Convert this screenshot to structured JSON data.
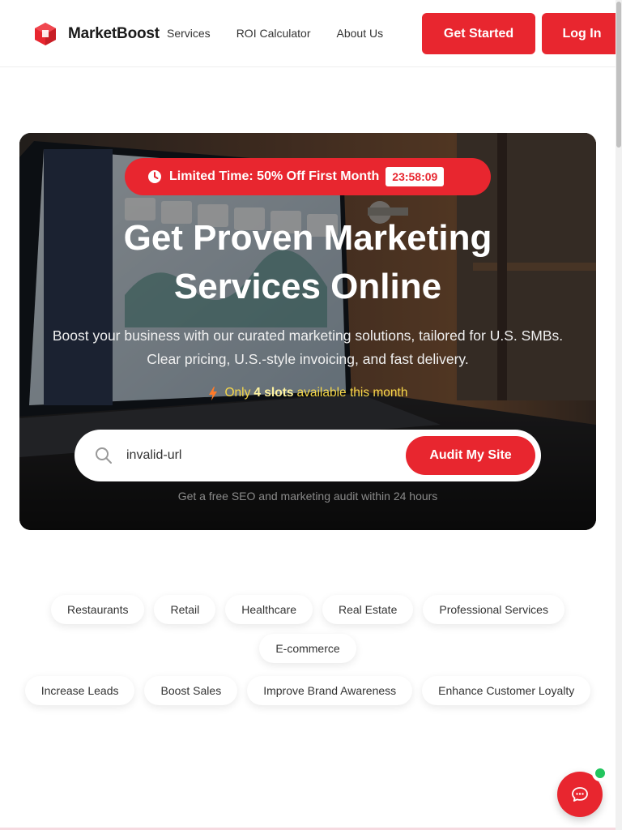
{
  "header": {
    "brand": "MarketBoost",
    "nav": [
      "Services",
      "ROI Calculator",
      "About Us"
    ],
    "get_started": "Get Started",
    "login": "Log In"
  },
  "hero": {
    "promo_text": "Limited Time: 50% Off First Month",
    "countdown": "23:58:09",
    "title_line1": "Get Proven Marketing",
    "title_line2": "Services Online",
    "subtitle": "Boost your business with our curated marketing solutions, tailored for U.S. SMBs. Clear pricing, U.S.-style invoicing, and fast delivery.",
    "slots_prefix": "Only",
    "slots_count": "4 slots",
    "slots_suffix": "available this month",
    "search_value": "invalid-url",
    "audit_button": "Audit My Site",
    "audit_note": "Get a free SEO and marketing audit within 24 hours"
  },
  "industries": [
    "Restaurants",
    "Retail",
    "Healthcare",
    "Real Estate",
    "Professional Services",
    "E-commerce"
  ],
  "goals": [
    "Increase Leads",
    "Boost Sales",
    "Improve Brand Awareness",
    "Enhance Customer Loyalty"
  ],
  "colors": {
    "accent": "#e8262f",
    "highlight": "#f7d84a",
    "online": "#22c55e"
  },
  "icons": {
    "logo": "cube-icon",
    "promo": "clock-icon",
    "slots": "lightning-icon",
    "search": "search-icon",
    "chat": "chat-bubble-icon"
  }
}
